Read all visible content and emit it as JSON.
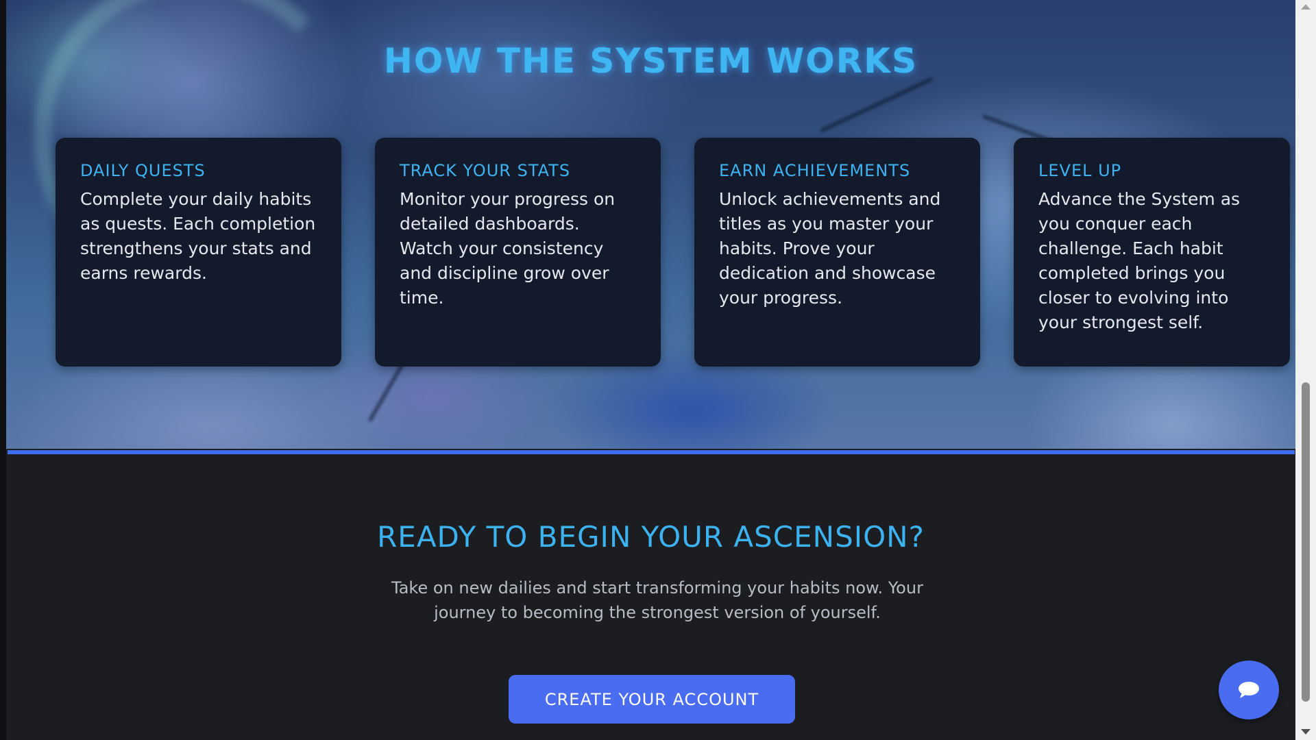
{
  "hero": {
    "title": "HOW THE SYSTEM WORKS",
    "cards": [
      {
        "title": "DAILY QUESTS",
        "text": "Complete your daily habits as quests. Each completion strengthens your stats and earns rewards."
      },
      {
        "title": "TRACK YOUR STATS",
        "text": "Monitor your progress on detailed dashboards. Watch your consistency and discipline grow over time."
      },
      {
        "title": "EARN ACHIEVEMENTS",
        "text": "Unlock achievements and titles as you master your habits. Prove your dedication and showcase your progress."
      },
      {
        "title": "LEVEL UP",
        "text": "Advance the System as you conquer each challenge. Each habit completed brings you closer to evolving into your strongest self."
      }
    ]
  },
  "cta": {
    "title": "READY TO BEGIN YOUR ASCENSION?",
    "text": "Take on new dailies and start transforming your habits now. Your journey to becoming the strongest version of yourself.",
    "button_label": "CREATE YOUR ACCOUNT"
  },
  "chat": {
    "icon": "chat-bubble-icon"
  },
  "colors": {
    "accent_blue": "#3fb6f2",
    "button_blue": "#4a6cf0",
    "card_bg": "#121a2c",
    "section_bg": "#1c1d21"
  }
}
